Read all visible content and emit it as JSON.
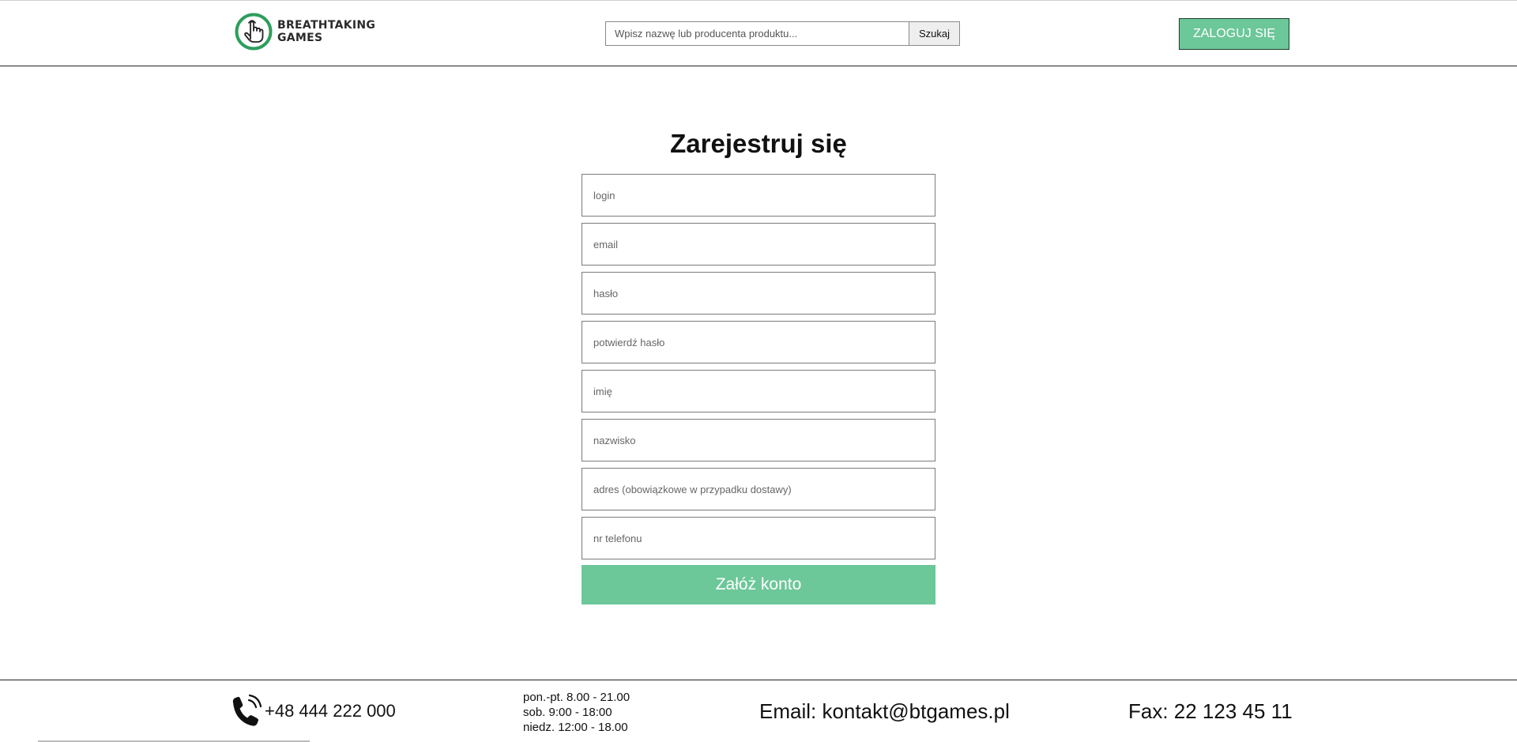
{
  "header": {
    "logo": {
      "line1": "BREATHTAKING",
      "line2": "GAMES",
      "icon": "hand-pointer-icon",
      "ring_color": "#2e9e5c"
    },
    "search": {
      "placeholder": "Wpisz nazwę lub producenta produktu...",
      "value": "",
      "button_label": "Szukaj"
    },
    "login_button_label": "ZALOGUJ SIĘ"
  },
  "form": {
    "title": "Zarejestruj się",
    "fields": [
      {
        "placeholder": "login",
        "value": ""
      },
      {
        "placeholder": "email",
        "value": ""
      },
      {
        "placeholder": "hasło",
        "value": ""
      },
      {
        "placeholder": "potwierdź hasło",
        "value": ""
      },
      {
        "placeholder": "imię",
        "value": ""
      },
      {
        "placeholder": "nazwisko",
        "value": ""
      },
      {
        "placeholder": "adres (obowiązkowe w przypadku dostawy)",
        "value": ""
      },
      {
        "placeholder": "nr telefonu",
        "value": ""
      }
    ],
    "submit_label": "Załóż konto"
  },
  "footer": {
    "phone": {
      "icon": "phone-icon",
      "text": "+48 444 222 000"
    },
    "hours": [
      "pon.-pt. 8.00 - 21.00",
      "sob. 9:00 - 18:00",
      "niedz. 12:00 - 18.00"
    ],
    "email": "Email: kontakt@btgames.pl",
    "fax": "Fax: 22 123 45 11"
  },
  "colors": {
    "accent": "#6cc799",
    "logo_ring": "#2e9e5c",
    "text": "#111111"
  }
}
